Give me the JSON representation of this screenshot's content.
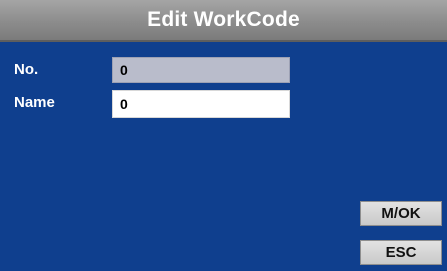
{
  "window": {
    "title": "Edit WorkCode"
  },
  "form": {
    "no_label": "No.",
    "no_value": "0",
    "name_label": "Name",
    "name_value": "0"
  },
  "buttons": {
    "ok_label": "M/OK",
    "esc_label": "ESC"
  },
  "colors": {
    "background": "#0f3f8e",
    "title_bar": "#8c8c8c",
    "readonly_field": "#b9bccb",
    "active_field": "#ffffff"
  }
}
